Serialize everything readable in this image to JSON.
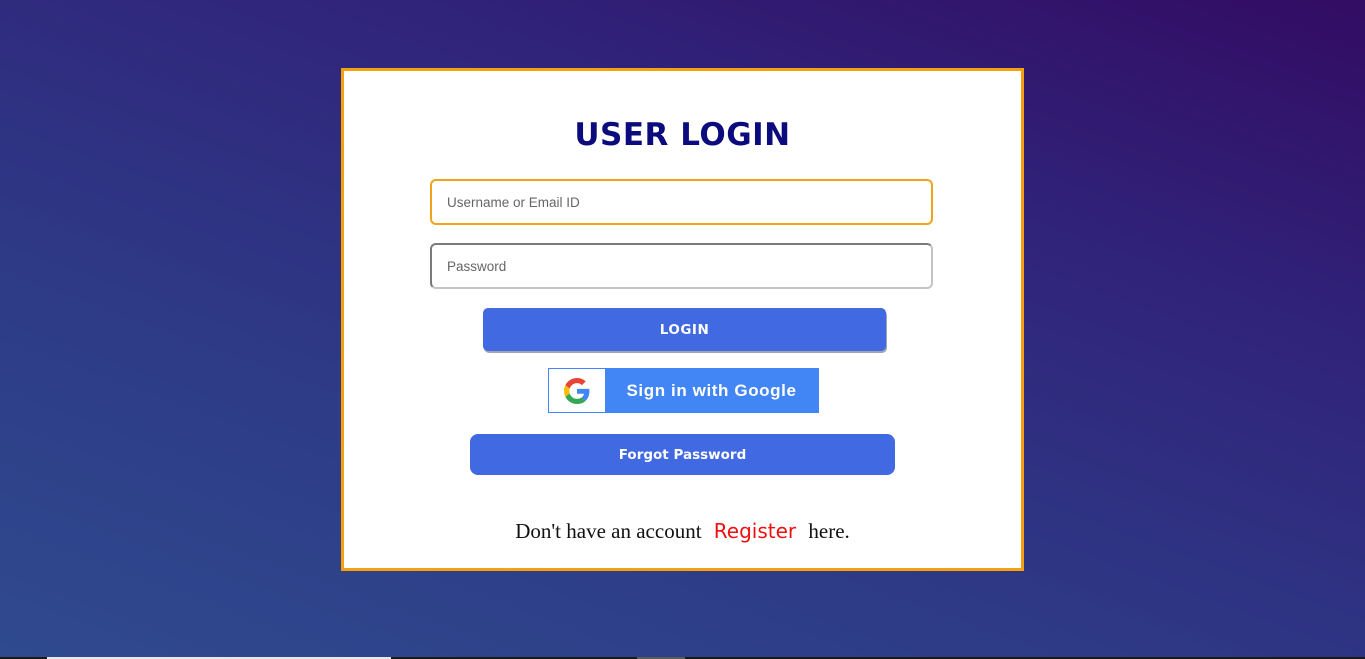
{
  "login_card": {
    "title": "USER LOGIN",
    "username_field": {
      "placeholder": "Username or Email ID",
      "value": ""
    },
    "password_field": {
      "placeholder": "Password",
      "value": ""
    },
    "login_button": "LOGIN",
    "google_button": {
      "label": "Sign in with Google",
      "icon": "google-g-icon"
    },
    "forgot_button": "Forgot Password",
    "register": {
      "prefix": "Don't have an account",
      "link": "Register",
      "suffix": "here."
    }
  },
  "colors": {
    "background_start": "#2f4a8f",
    "background_end": "#330c63",
    "card_border": "#f5a00f",
    "title": "#0b0b7d",
    "button": "#4169e1",
    "google_blue": "#4285f4",
    "register_link": "#ef1111"
  }
}
